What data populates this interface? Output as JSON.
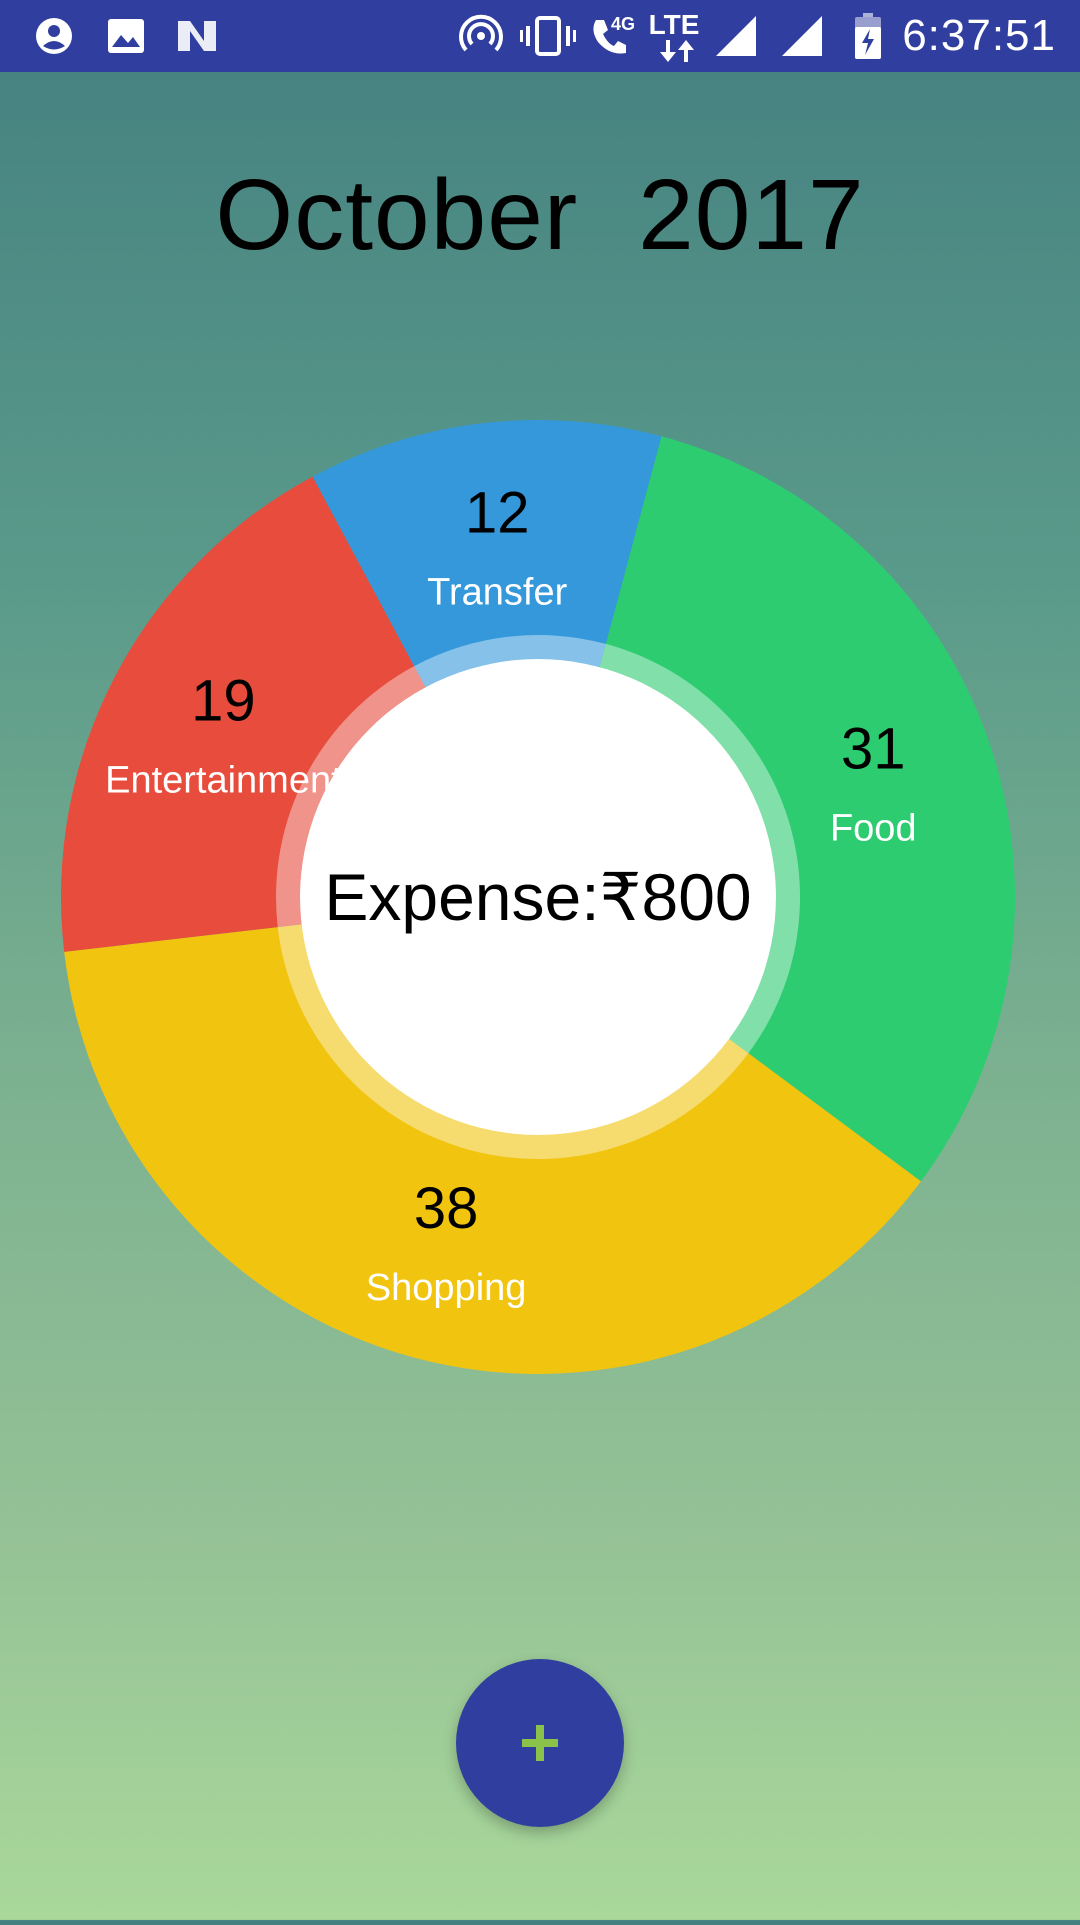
{
  "status_bar": {
    "time": "6:37:51",
    "network_label_4g": "4G",
    "network_label_lte": "LTE",
    "icons": [
      "account-circle-icon",
      "image-icon",
      "n-logo-icon",
      "hotspot-icon",
      "vibrate-icon",
      "wifi-call-icon",
      "lte-data-icon",
      "signal-icon",
      "signal-icon",
      "battery-charging-icon"
    ]
  },
  "header": {
    "month": "October",
    "year": "2017"
  },
  "expense": {
    "label": "Expense:₹800"
  },
  "chart_data": {
    "type": "pie",
    "categories": [
      "Food",
      "Shopping",
      "Entertainment",
      "Transfer"
    ],
    "values": [
      31,
      38,
      19,
      12
    ],
    "colors": [
      "#2ecc71",
      "#f1c40f",
      "#e74c3c",
      "#3498db"
    ],
    "center_label": "Expense:₹800"
  },
  "fab": {
    "icon": "plus-icon",
    "icon_color": "#8bc34a",
    "background": "#303f9f"
  }
}
